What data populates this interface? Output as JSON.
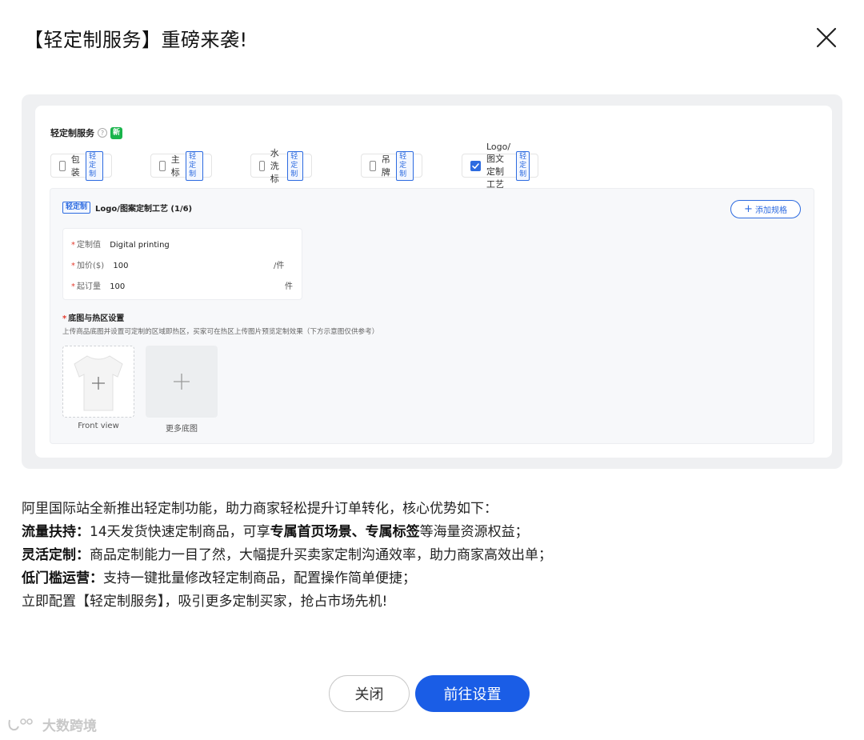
{
  "modal": {
    "title": "【轻定制服务】重磅来袭!",
    "close_icon": "close-icon"
  },
  "preview": {
    "service_label": "轻定制服务",
    "new_badge": "新",
    "tag_label": "轻定制",
    "options": [
      {
        "label": "包装",
        "checked": false
      },
      {
        "label": "主标",
        "checked": false
      },
      {
        "label": "水洗标",
        "checked": false
      },
      {
        "label": "吊牌",
        "checked": false
      },
      {
        "label": "Logo/图文定制工艺",
        "checked": true
      }
    ],
    "config": {
      "tag": "轻定制",
      "title": "Logo/图案定制工艺 (1/6)",
      "add_spec": "添加规格",
      "rows": [
        {
          "label": "定制值",
          "value": "Digital printing",
          "unit": ""
        },
        {
          "label": "加价($)",
          "value": "100",
          "unit": "/件"
        },
        {
          "label": "起订量",
          "value": "100",
          "unit": "件"
        }
      ],
      "base_title": "底图与热区设置",
      "base_desc": "上传商品底图并设置可定制的区域即热区，买家可在热区上传图片预览定制效果（下方示意图仅供参考）",
      "images": [
        {
          "caption": "Front view"
        },
        {
          "caption": "更多底图"
        }
      ]
    }
  },
  "description": {
    "intro": "阿里国际站全新推出轻定制功能，助力商家轻松提升订单转化，核心优势如下：",
    "line1": {
      "head": "流量扶持：",
      "a": "14天发货快速定制商品，可享",
      "b": "专属首页场景、专属标签",
      "c": "等海量资源权益；"
    },
    "line2": {
      "head": "灵活定制：",
      "body": "商品定制能力一目了然，大幅提升买卖家定制沟通效率，助力商家高效出单；"
    },
    "line3": {
      "head": "低门槛运营：",
      "body": "支持一键批量修改轻定制商品，配置操作简单便捷；"
    },
    "outro": "立即配置【轻定制服务】，吸引更多定制买家，抢占市场先机!"
  },
  "buttons": {
    "close": "关闭",
    "go": "前往设置"
  },
  "watermark": "大数跨境",
  "colors": {
    "primary": "#1a5de6",
    "tag_blue": "#2d6be0",
    "new_green": "#19b44b",
    "required_red": "#e43d30"
  }
}
